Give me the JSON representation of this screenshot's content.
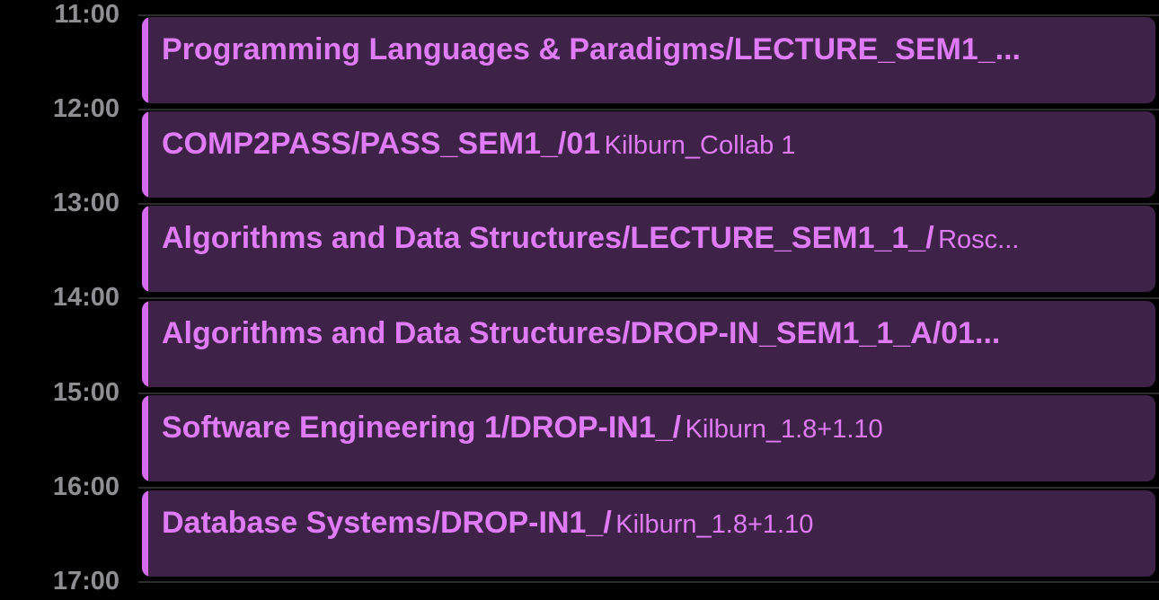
{
  "hours": [
    "11:00",
    "12:00",
    "13:00",
    "14:00",
    "15:00",
    "16:00",
    "17:00"
  ],
  "events": [
    {
      "title": "Programming Languages & Paradigms/LECTURE_SEM1_...",
      "location": ""
    },
    {
      "title": "COMP2PASS/PASS_SEM1_/01",
      "location": "Kilburn_Collab 1"
    },
    {
      "title": "Algorithms and Data Structures/LECTURE_SEM1_1_/",
      "location": "Rosc..."
    },
    {
      "title": "Algorithms and Data Structures/DROP-IN_SEM1_1_A/01...",
      "location": ""
    },
    {
      "title": "Software Engineering 1/DROP-IN1_/",
      "location": "Kilburn_1.8+1.10"
    },
    {
      "title": "Database Systems/DROP-IN1_/",
      "location": "Kilburn_1.8+1.10"
    }
  ],
  "colors": {
    "background": "#000000",
    "event_fill": "#3e2248",
    "event_accent": "#d56cf0",
    "event_text": "#e07bf7",
    "hour_label": "#8e8e93",
    "grid_line": "#2c2c2e"
  }
}
